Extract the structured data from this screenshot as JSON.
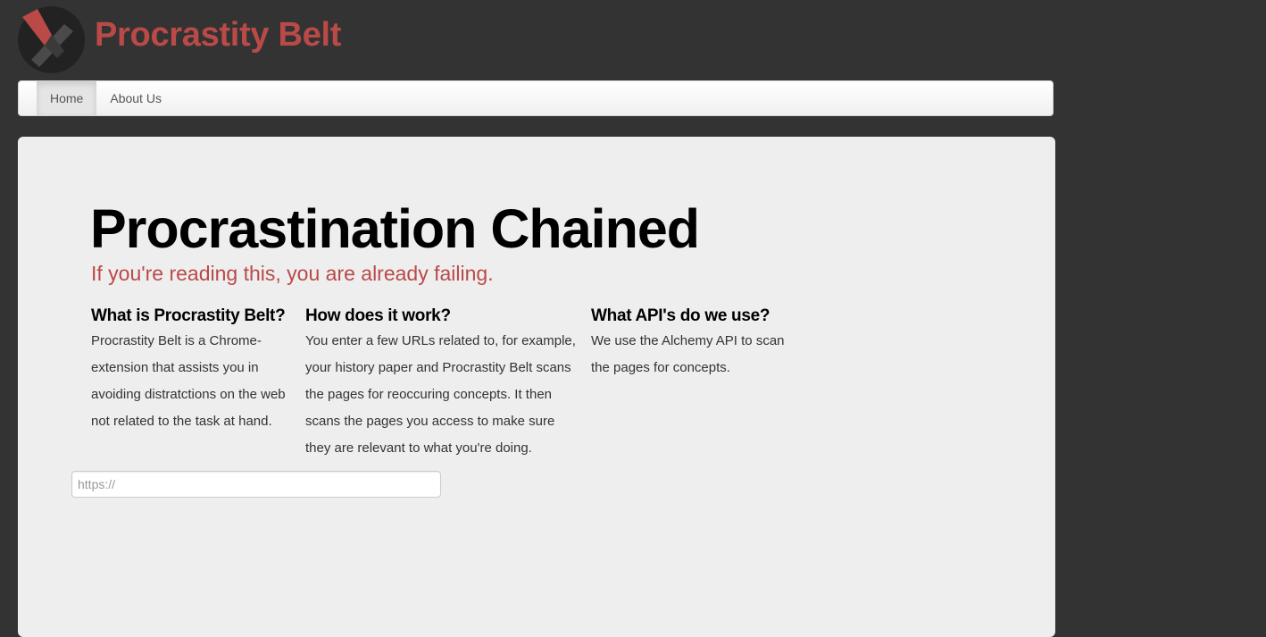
{
  "header": {
    "brand": "Procrastity Belt",
    "logo_icon": "chain-logo-icon",
    "logo_colors": {
      "ring": "#222222",
      "accent": "#b94a48",
      "slash": "#555555"
    }
  },
  "nav": {
    "items": [
      {
        "label": "Home",
        "active": true
      },
      {
        "label": "About Us",
        "active": false
      }
    ]
  },
  "hero": {
    "title": "Procrastination Chained",
    "subtitle": "If you're reading this, you are already failing."
  },
  "columns": [
    {
      "heading": "What is Procrastity Belt?",
      "body": "Procrastity Belt is a Chrome-extension that assists you in avoiding distratctions on the web not related to the task at hand."
    },
    {
      "heading": "How does it work?",
      "body": "You enter a few URLs related to, for example, your history paper and Procrastity Belt scans the pages for reoccuring concepts. It then scans the pages you access to make sure they are relevant to what you're doing."
    },
    {
      "heading": "What API's do we use?",
      "body": "We use the Alchemy API to scan the pages for concepts."
    }
  ],
  "url_input": {
    "placeholder": "https://",
    "value": ""
  },
  "colors": {
    "background": "#333333",
    "brand": "#b94a48",
    "panel": "#eeeeee"
  }
}
